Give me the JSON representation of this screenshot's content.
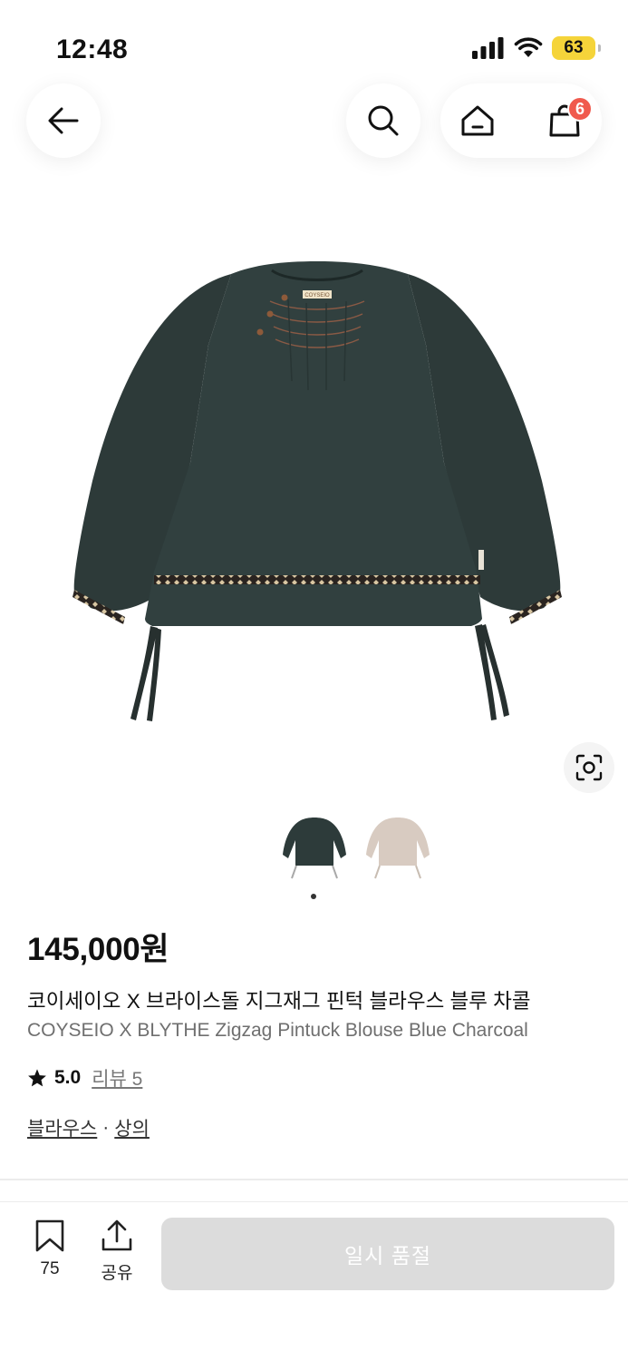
{
  "status_bar": {
    "time": "12:48",
    "battery": "63"
  },
  "nav": {
    "cart_count": "6"
  },
  "product": {
    "price": "145,000원",
    "name_ko": "코이세이오 X 브라이스돌 지그재그 핀턱 블라우스 블루 차콜",
    "name_en": "COYSEIO X BLYTHE Zigzag Pintuck Blouse Blue Charcoal",
    "rating": "5.0",
    "review_label": "리뷰 5",
    "categories": [
      "블라우스",
      "상의"
    ],
    "category_separator": "·",
    "neck_label": "COYSEIO",
    "thumbnail_colors": [
      "#2d3b3a",
      "#d8cbc1"
    ],
    "image_page": 1,
    "image_pages_total": 1
  },
  "bottom_bar": {
    "bookmark_count": "75",
    "share_label": "공유",
    "cta_label": "일시 품절"
  }
}
